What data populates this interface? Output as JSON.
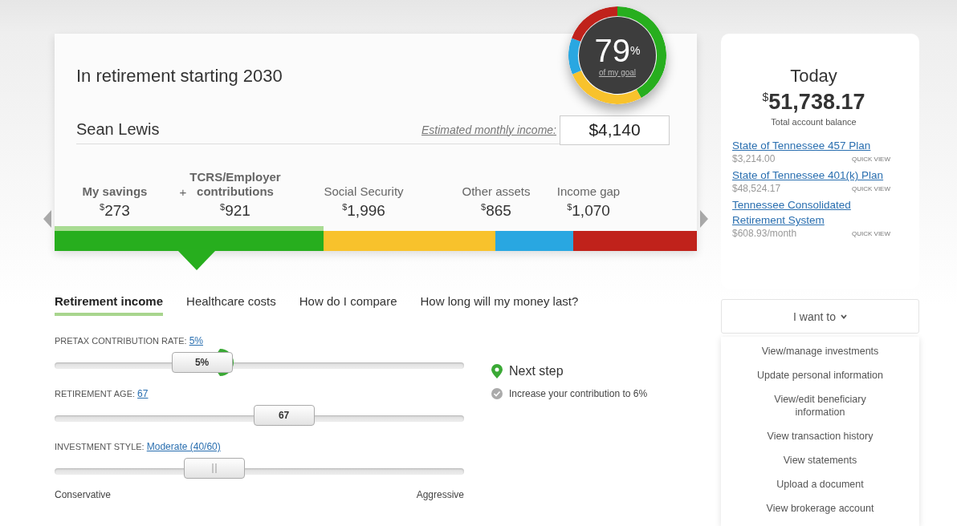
{
  "summary": {
    "title": "In retirement starting 2030",
    "name": "Sean Lewis",
    "income_label": "Estimated monthly income",
    "income_colon": ":",
    "income_value": "$4,140",
    "gauge": {
      "value": "79",
      "unit": "%",
      "caption": "of my goal"
    },
    "breakdown": [
      {
        "kind": "item",
        "label": "My savings",
        "currency": "$",
        "amount": "273",
        "bold": true
      },
      {
        "kind": "operator",
        "label": "+"
      },
      {
        "kind": "item",
        "label": "TCRS/Employer contributions",
        "currency": "$",
        "amount": "921",
        "bold": true
      },
      {
        "kind": "item",
        "label": "Social Security",
        "currency": "$",
        "amount": "1,996",
        "bold": false
      },
      {
        "kind": "item",
        "label": "Other assets",
        "currency": "$",
        "amount": "865",
        "bold": false
      },
      {
        "kind": "item",
        "label": "Income gap",
        "currency": "$",
        "amount": "1,070",
        "bold": false
      }
    ],
    "segments": [
      {
        "color": "#27ae1e"
      },
      {
        "color": "#f8c22c"
      },
      {
        "color": "#29a7e1"
      },
      {
        "color": "#c0221b"
      }
    ]
  },
  "tabs": [
    {
      "label": "Retirement income",
      "selected": true
    },
    {
      "label": "Healthcare costs",
      "selected": false
    },
    {
      "label": "How do I compare",
      "selected": false
    },
    {
      "label": "How long will my money last?",
      "selected": false
    }
  ],
  "sliders": [
    {
      "label": "PRETAX CONTRIBUTION RATE:",
      "value": "5%",
      "thumb": "5%",
      "level": 0.36,
      "goal_marker": true
    },
    {
      "label": "RETIREMENT AGE:",
      "value": "67",
      "thumb": "67",
      "level": 0.56,
      "goal_marker": false
    },
    {
      "label": "INVESTMENT STYLE:",
      "value": "Moderate (40/60)",
      "level": 0.39,
      "goal_marker": false,
      "min_label": "Conservative",
      "max_label": "Aggressive"
    }
  ],
  "next_step": {
    "title": "Next step",
    "items": [
      {
        "text": "Increase your contribution to 6%",
        "done": false
      }
    ]
  },
  "today": {
    "title": "Today",
    "currency": "$",
    "balance": "51,738.17",
    "caption": "Total account balance",
    "accounts": [
      {
        "name": "State of Tennessee 457 Plan",
        "amount": "$3,214.00",
        "action": "QUICK VIEW"
      },
      {
        "name": "State of Tennessee 401(k) Plan",
        "amount": "$48,524.17",
        "action": "QUICK VIEW"
      },
      {
        "name": "Tennessee Consolidated Retirement System",
        "amount": "$608.93/month",
        "action": "QUICK VIEW"
      }
    ]
  },
  "menu": {
    "label": "I want to",
    "expanded": true,
    "items": [
      "View/manage investments",
      "Update personal information",
      "View/edit beneficiary information",
      "View transaction history",
      "View statements",
      "Upload a document",
      "View brokerage account"
    ]
  }
}
